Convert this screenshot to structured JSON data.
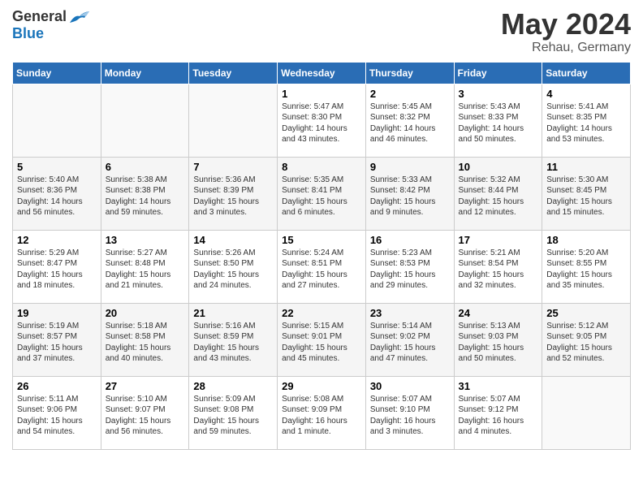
{
  "header": {
    "logo_general": "General",
    "logo_blue": "Blue",
    "title": "May 2024",
    "location": "Rehau, Germany"
  },
  "days_of_week": [
    "Sunday",
    "Monday",
    "Tuesday",
    "Wednesday",
    "Thursday",
    "Friday",
    "Saturday"
  ],
  "weeks": [
    {
      "days": [
        {
          "num": "",
          "info": ""
        },
        {
          "num": "",
          "info": ""
        },
        {
          "num": "",
          "info": ""
        },
        {
          "num": "1",
          "info": "Sunrise: 5:47 AM\nSunset: 8:30 PM\nDaylight: 14 hours\nand 43 minutes."
        },
        {
          "num": "2",
          "info": "Sunrise: 5:45 AM\nSunset: 8:32 PM\nDaylight: 14 hours\nand 46 minutes."
        },
        {
          "num": "3",
          "info": "Sunrise: 5:43 AM\nSunset: 8:33 PM\nDaylight: 14 hours\nand 50 minutes."
        },
        {
          "num": "4",
          "info": "Sunrise: 5:41 AM\nSunset: 8:35 PM\nDaylight: 14 hours\nand 53 minutes."
        }
      ]
    },
    {
      "days": [
        {
          "num": "5",
          "info": "Sunrise: 5:40 AM\nSunset: 8:36 PM\nDaylight: 14 hours\nand 56 minutes."
        },
        {
          "num": "6",
          "info": "Sunrise: 5:38 AM\nSunset: 8:38 PM\nDaylight: 14 hours\nand 59 minutes."
        },
        {
          "num": "7",
          "info": "Sunrise: 5:36 AM\nSunset: 8:39 PM\nDaylight: 15 hours\nand 3 minutes."
        },
        {
          "num": "8",
          "info": "Sunrise: 5:35 AM\nSunset: 8:41 PM\nDaylight: 15 hours\nand 6 minutes."
        },
        {
          "num": "9",
          "info": "Sunrise: 5:33 AM\nSunset: 8:42 PM\nDaylight: 15 hours\nand 9 minutes."
        },
        {
          "num": "10",
          "info": "Sunrise: 5:32 AM\nSunset: 8:44 PM\nDaylight: 15 hours\nand 12 minutes."
        },
        {
          "num": "11",
          "info": "Sunrise: 5:30 AM\nSunset: 8:45 PM\nDaylight: 15 hours\nand 15 minutes."
        }
      ]
    },
    {
      "days": [
        {
          "num": "12",
          "info": "Sunrise: 5:29 AM\nSunset: 8:47 PM\nDaylight: 15 hours\nand 18 minutes."
        },
        {
          "num": "13",
          "info": "Sunrise: 5:27 AM\nSunset: 8:48 PM\nDaylight: 15 hours\nand 21 minutes."
        },
        {
          "num": "14",
          "info": "Sunrise: 5:26 AM\nSunset: 8:50 PM\nDaylight: 15 hours\nand 24 minutes."
        },
        {
          "num": "15",
          "info": "Sunrise: 5:24 AM\nSunset: 8:51 PM\nDaylight: 15 hours\nand 27 minutes."
        },
        {
          "num": "16",
          "info": "Sunrise: 5:23 AM\nSunset: 8:53 PM\nDaylight: 15 hours\nand 29 minutes."
        },
        {
          "num": "17",
          "info": "Sunrise: 5:21 AM\nSunset: 8:54 PM\nDaylight: 15 hours\nand 32 minutes."
        },
        {
          "num": "18",
          "info": "Sunrise: 5:20 AM\nSunset: 8:55 PM\nDaylight: 15 hours\nand 35 minutes."
        }
      ]
    },
    {
      "days": [
        {
          "num": "19",
          "info": "Sunrise: 5:19 AM\nSunset: 8:57 PM\nDaylight: 15 hours\nand 37 minutes."
        },
        {
          "num": "20",
          "info": "Sunrise: 5:18 AM\nSunset: 8:58 PM\nDaylight: 15 hours\nand 40 minutes."
        },
        {
          "num": "21",
          "info": "Sunrise: 5:16 AM\nSunset: 8:59 PM\nDaylight: 15 hours\nand 43 minutes."
        },
        {
          "num": "22",
          "info": "Sunrise: 5:15 AM\nSunset: 9:01 PM\nDaylight: 15 hours\nand 45 minutes."
        },
        {
          "num": "23",
          "info": "Sunrise: 5:14 AM\nSunset: 9:02 PM\nDaylight: 15 hours\nand 47 minutes."
        },
        {
          "num": "24",
          "info": "Sunrise: 5:13 AM\nSunset: 9:03 PM\nDaylight: 15 hours\nand 50 minutes."
        },
        {
          "num": "25",
          "info": "Sunrise: 5:12 AM\nSunset: 9:05 PM\nDaylight: 15 hours\nand 52 minutes."
        }
      ]
    },
    {
      "days": [
        {
          "num": "26",
          "info": "Sunrise: 5:11 AM\nSunset: 9:06 PM\nDaylight: 15 hours\nand 54 minutes."
        },
        {
          "num": "27",
          "info": "Sunrise: 5:10 AM\nSunset: 9:07 PM\nDaylight: 15 hours\nand 56 minutes."
        },
        {
          "num": "28",
          "info": "Sunrise: 5:09 AM\nSunset: 9:08 PM\nDaylight: 15 hours\nand 59 minutes."
        },
        {
          "num": "29",
          "info": "Sunrise: 5:08 AM\nSunset: 9:09 PM\nDaylight: 16 hours\nand 1 minute."
        },
        {
          "num": "30",
          "info": "Sunrise: 5:07 AM\nSunset: 9:10 PM\nDaylight: 16 hours\nand 3 minutes."
        },
        {
          "num": "31",
          "info": "Sunrise: 5:07 AM\nSunset: 9:12 PM\nDaylight: 16 hours\nand 4 minutes."
        },
        {
          "num": "",
          "info": ""
        }
      ]
    }
  ]
}
